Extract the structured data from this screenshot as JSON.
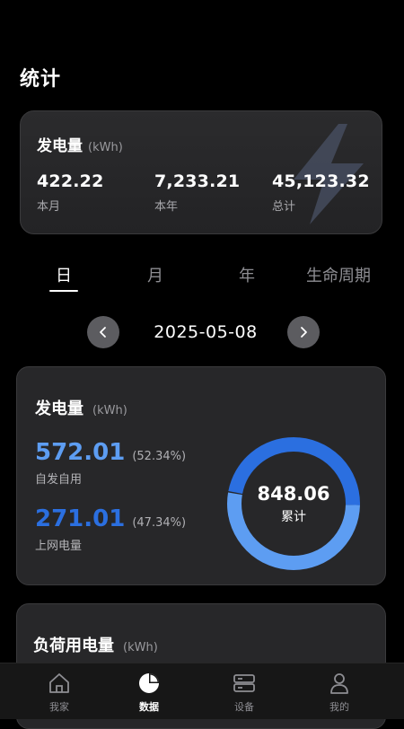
{
  "header": {
    "title": "统计"
  },
  "summary": {
    "title": "发电量",
    "unit": "(kWh)",
    "stats": [
      {
        "value": "422.22",
        "label": "本月"
      },
      {
        "value": "7,233.21",
        "label": "本年"
      },
      {
        "value": "45,123.32",
        "label": "总计"
      }
    ]
  },
  "tabs": [
    "日",
    "月",
    "年",
    "生命周期"
  ],
  "date": {
    "value": "2025-05-08"
  },
  "generation": {
    "title": "发电量",
    "unit": "(kWh)",
    "self_use": {
      "value": "572.01",
      "percent": "(52.34%)",
      "label": "自发自用",
      "color": "#5d9df2"
    },
    "grid": {
      "value": "271.01",
      "percent": "(47.34%)",
      "label": "上网电量",
      "color": "#2b6fe0"
    },
    "total": {
      "value": "848.06",
      "label": "累计"
    },
    "donut": {
      "self_use_fraction": 0.5234,
      "grid_fraction": 0.4734
    }
  },
  "load": {
    "title": "负荷用电量",
    "unit": "(kWh)"
  },
  "nav": [
    {
      "label": "我家",
      "icon": "home-icon"
    },
    {
      "label": "数据",
      "icon": "pie-chart-icon"
    },
    {
      "label": "设备",
      "icon": "device-icon"
    },
    {
      "label": "我的",
      "icon": "profile-icon"
    }
  ]
}
